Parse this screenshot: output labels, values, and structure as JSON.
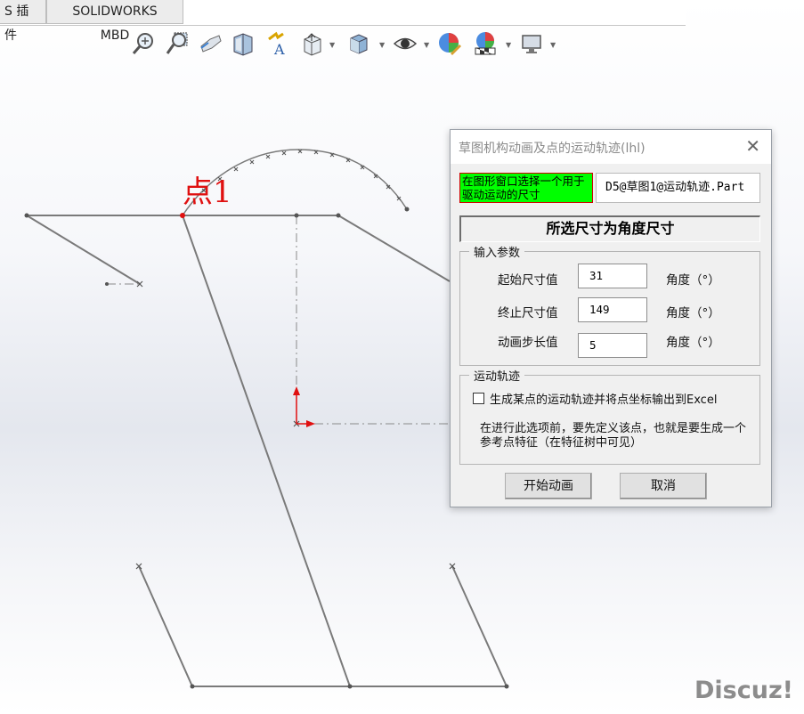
{
  "tabs": [
    {
      "label": "S 插件"
    },
    {
      "label": "SOLIDWORKS MBD"
    }
  ],
  "toolbar": {
    "icons": [
      "zoom-to-fit-icon",
      "zoom-to-area-icon",
      "previous-view-icon",
      "section-view-icon",
      "dynamic-annotation-icon",
      "view-orientation-icon",
      "display-style-icon",
      "hide-show-items-icon",
      "edit-appearance-icon",
      "apply-scene-icon",
      "view-settings-icon"
    ]
  },
  "sketch": {
    "point_label": "点1"
  },
  "dialog": {
    "title": "草图机构动画及点的运动轨迹(lhl)",
    "select_prompt": "在图形窗口选择一个用于驱动运动的尺寸",
    "selected_dimension": "D5@草图1@运动轨迹.Part",
    "dimension_type_banner": "所选尺寸为角度尺寸",
    "input_group": {
      "title": "输入参数",
      "params": [
        {
          "label": "起始尺寸值",
          "value": "31",
          "unit": "角度（°）"
        },
        {
          "label": "终止尺寸值",
          "value": "149",
          "unit": "角度（°）"
        },
        {
          "label": "动画步长值",
          "value": "5",
          "unit": "角度（°）"
        }
      ]
    },
    "track_group": {
      "title": "运动轨迹",
      "checkbox_label": "生成某点的运动轨迹并将点坐标输出到Excel",
      "checked": false,
      "note": "在进行此选项前，要先定义该点，也就是要生成一个参考点特征（在特征树中可见）"
    },
    "buttons": {
      "start": "开始动画",
      "cancel": "取消"
    }
  },
  "watermark": "Discuz!",
  "colors": {
    "green_highlight": "#00ff00",
    "point_red": "#e01010",
    "sketch_gray": "#7a7a7a"
  }
}
